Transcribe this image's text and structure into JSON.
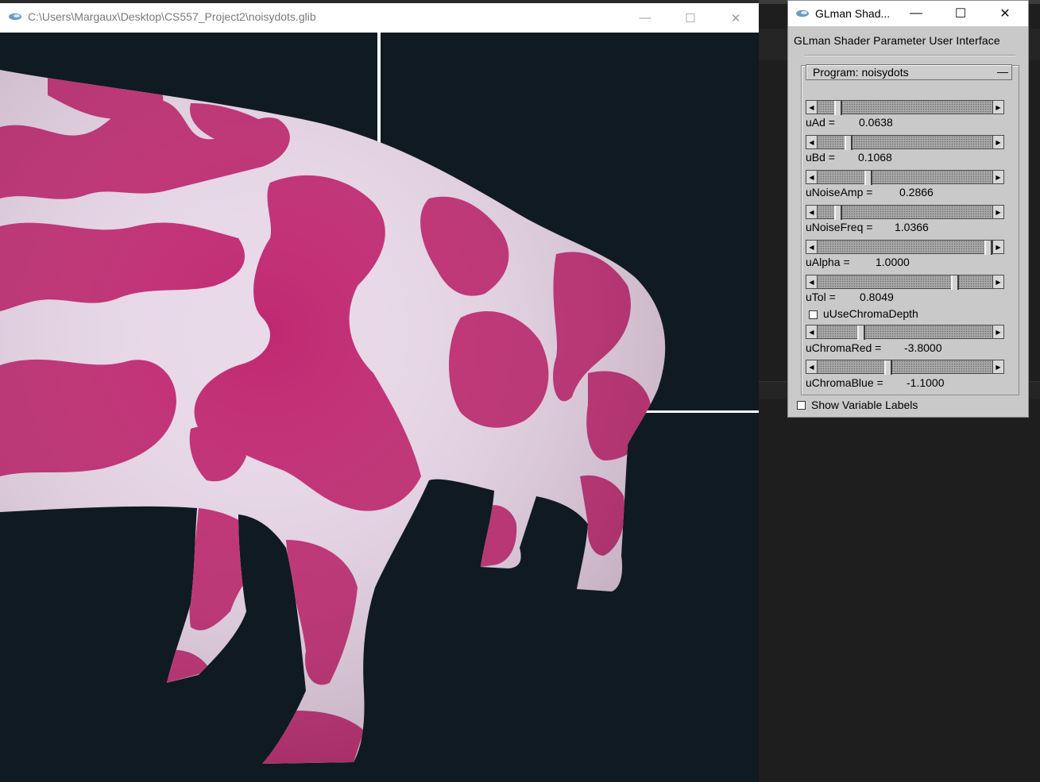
{
  "main_window": {
    "title": "C:\\Users\\Margaux\\Desktop\\CS557_Project2\\noisydots.glib",
    "controls": {
      "minimize": "—",
      "maximize": "☐",
      "close": "✕"
    }
  },
  "scene": {
    "subject": "3D cow model rendered with noisy pink dot shader",
    "background_color": "#101a22",
    "base_color": "#ede0ee",
    "dot_color": "#c02870"
  },
  "panel": {
    "title": "GLman Shad...",
    "controls": {
      "minimize": "—",
      "maximize": "☐",
      "close": "✕"
    },
    "heading": "GLman Shader Parameter User Interface",
    "program_label": "Program: noisydots",
    "collapse_glyph": "—",
    "params": [
      {
        "label": "uAd =",
        "value": "0.0638",
        "level": 0.1
      },
      {
        "label": "uBd =",
        "value": "0.1068",
        "level": 0.16
      },
      {
        "label": "uNoiseAmp =",
        "value": "0.2866",
        "level": 0.28
      },
      {
        "label": "uNoiseFreq =",
        "value": "1.0366",
        "level": 0.1
      },
      {
        "label": "uAlpha =",
        "value": "1.0000",
        "level": 1.0
      },
      {
        "label": "uTol =",
        "value": "0.8049",
        "level": 0.8
      },
      {
        "checkbox": true,
        "label": "uUseChromaDepth",
        "checked": false
      },
      {
        "label": "uChromaRed =",
        "value": "-3.8000",
        "level": 0.24
      },
      {
        "label": "uChromaBlue =",
        "value": "-1.1000",
        "level": 0.4
      }
    ],
    "show_labels": {
      "label": "Show Variable Labels",
      "checked": false
    },
    "arrow_left": "◀",
    "arrow_right": "▶"
  }
}
